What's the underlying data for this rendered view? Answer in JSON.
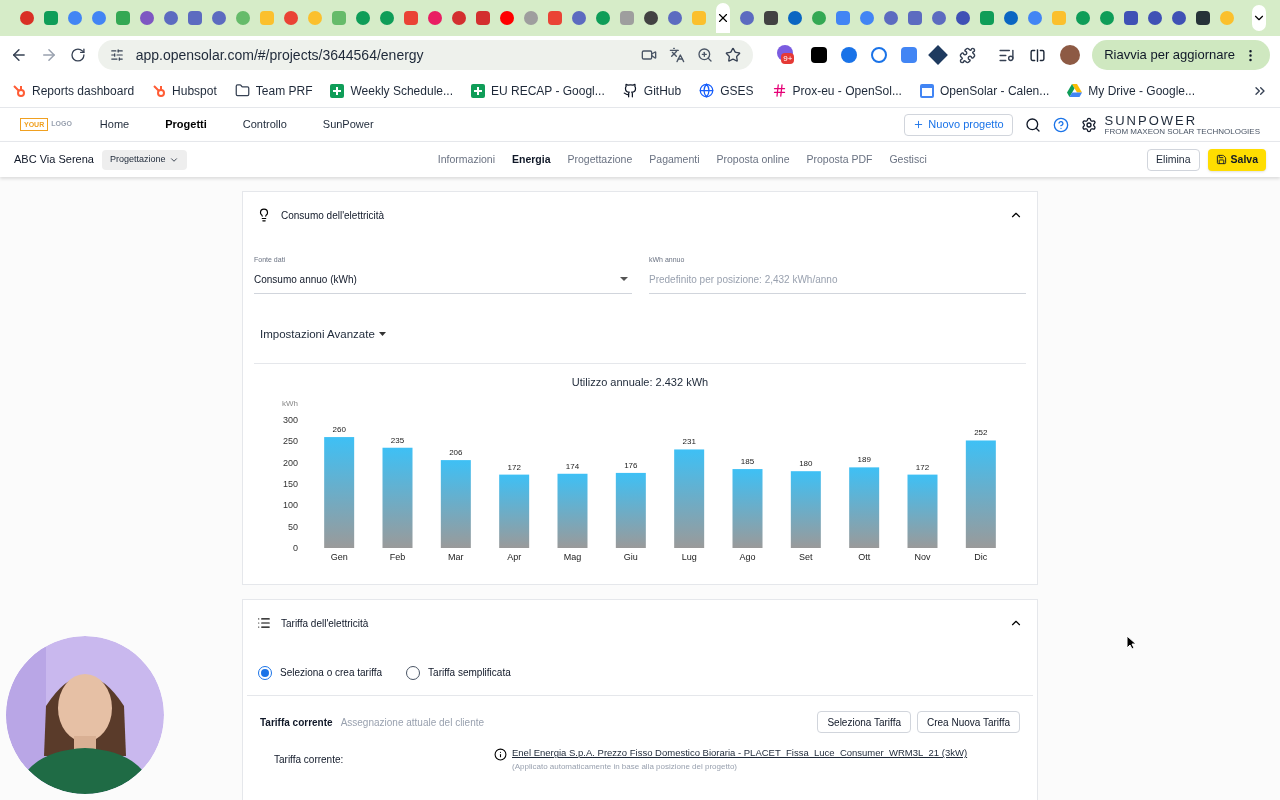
{
  "browser": {
    "address": "app.opensolar.com/#/projects/3644564/energy",
    "extension_badge": "9+",
    "update_button": "Riavvia per aggiornare",
    "bookmarks": [
      {
        "label": "Reports dashboard",
        "kind": "hubspot"
      },
      {
        "label": "Hubspot",
        "kind": "hubspot"
      },
      {
        "label": "Team PRF",
        "kind": "folder"
      },
      {
        "label": "Weekly Schedule...",
        "kind": "sheet"
      },
      {
        "label": "EU RECAP - Googl...",
        "kind": "sheet"
      },
      {
        "label": "GitHub",
        "kind": "github"
      },
      {
        "label": "GSES",
        "kind": "globe"
      },
      {
        "label": "Prox-eu - OpenSol...",
        "kind": "slack"
      },
      {
        "label": "OpenSolar - Calen...",
        "kind": "calendar"
      },
      {
        "label": "My Drive - Google...",
        "kind": "drive"
      }
    ]
  },
  "app": {
    "logo": [
      "YOUR",
      "LOGO"
    ],
    "nav": [
      {
        "label": "Home",
        "selected": false
      },
      {
        "label": "Progetti",
        "selected": true
      },
      {
        "label": "Controllo",
        "selected": false
      },
      {
        "label": "SunPower",
        "selected": false
      }
    ],
    "new_project_button": "Nuovo progetto",
    "brand": "SUNPOWER",
    "brand_tagline": "FROM MAXEON SOLAR TECHNOLOGIES"
  },
  "project_bar": {
    "project_name": "ABC Via Serena",
    "stage": "Progettazione",
    "tabs": [
      {
        "label": "Informazioni",
        "selected": false
      },
      {
        "label": "Energia",
        "selected": true
      },
      {
        "label": "Progettazione",
        "selected": false
      },
      {
        "label": "Pagamenti",
        "selected": false
      },
      {
        "label": "Proposta online",
        "selected": false
      },
      {
        "label": "Proposta PDF",
        "selected": false
      },
      {
        "label": "Gestisci",
        "selected": false
      }
    ],
    "delete_button": "Elimina",
    "save_button": "Salva"
  },
  "consumption_card": {
    "title": "Consumo dell'elettricità",
    "expanded": true,
    "data_source": {
      "label": "Fonte dati",
      "value": "Consumo annuo (kWh)"
    },
    "annual_kwh": {
      "label": "kWh annuo",
      "placeholder": "Predefinito per posizione: 2,432 kWh/anno"
    },
    "advanced": "Impostazioni Avanzate",
    "chart_data": {
      "type": "bar",
      "title": "Utilizzo annuale: 2.432 kWh",
      "ylabel": "kWh",
      "categories": [
        "Gen",
        "Feb",
        "Mar",
        "Apr",
        "Mag",
        "Giu",
        "Lug",
        "Ago",
        "Set",
        "Ott",
        "Nov",
        "Dic"
      ],
      "values": [
        260,
        235,
        206,
        172,
        174,
        176,
        231,
        185,
        180,
        189,
        172,
        252
      ],
      "ylim": [
        0,
        300
      ],
      "yticks": [
        0,
        50,
        100,
        150,
        200,
        250,
        300
      ],
      "data_labels": true
    }
  },
  "tariff_card": {
    "title": "Tariffa dell'elettricità",
    "expanded": true,
    "options": [
      {
        "label": "Seleziona o crea tariffa",
        "selected": true
      },
      {
        "label": "Tariffa semplificata",
        "selected": false
      }
    ],
    "current": {
      "title": "Tariffa corrente",
      "subtitle": "Assegnazione attuale del cliente"
    },
    "buttons": [
      "Seleziona Tariffa",
      "Crea Nuova Tariffa"
    ],
    "row": {
      "label": "Tariffa corrente:",
      "link": "Enel Energia S.p.A. Prezzo Fisso Domestico Bioraria - PLACET_Fissa_Luce_Consumer_WRM3L_21 (3kW)",
      "note": "(Applicato automaticamente in base alla posizione del progetto)"
    }
  }
}
